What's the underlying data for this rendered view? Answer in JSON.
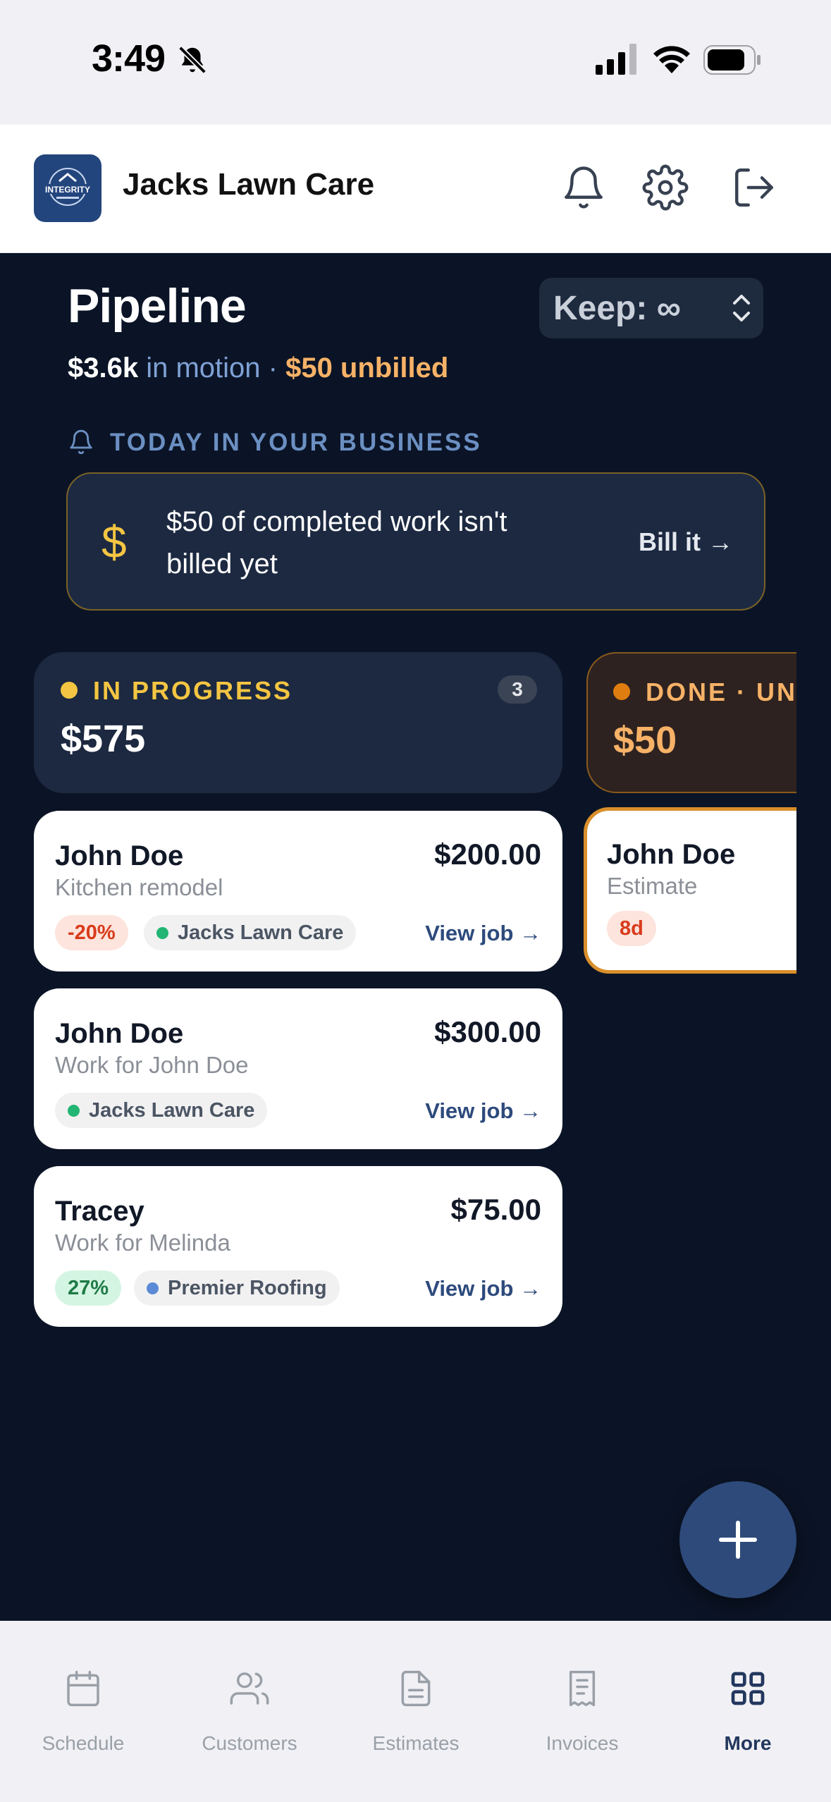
{
  "status_bar": {
    "time": "3:49"
  },
  "header": {
    "app_name": "Jacks Lawn Care",
    "logo_text": "INTEGRITY"
  },
  "pipeline": {
    "title": "Pipeline",
    "keep_select": "Keep: ∞",
    "summary": {
      "in_motion_value": "$3.6k",
      "in_motion_label": " in motion · ",
      "unbilled": "$50 unbilled"
    },
    "today_label": "TODAY IN YOUR BUSINESS",
    "alert": {
      "icon": "$",
      "text": "$50 of completed work isn't billed yet",
      "action": "Bill it →"
    }
  },
  "columns": {
    "in_progress": {
      "label": "IN PROGRESS",
      "count": "3",
      "amount": "$575",
      "dot_color": "#f4c542"
    },
    "done": {
      "label": "DONE · UNBILLED",
      "amount": "$50",
      "dot_color": "#e07d10"
    }
  },
  "cards": [
    {
      "name": "John Doe",
      "amount": "$200.00",
      "subtitle": "Kitchen remodel",
      "badge": "-20%",
      "company": "Jacks Lawn Care",
      "company_dot": "#22b573",
      "action": "View job →"
    },
    {
      "name": "John Doe",
      "amount": "$300.00",
      "subtitle": "Work for John Doe",
      "company": "Jacks Lawn Care",
      "company_dot": "#22b573",
      "action": "View job →"
    },
    {
      "name": "Tracey",
      "amount": "$75.00",
      "subtitle": "Work for Melinda",
      "badge": "27%",
      "company": "Premier Roofing",
      "company_dot": "#5b8bd6",
      "action": "View job →"
    }
  ],
  "done_card": {
    "name": "John Doe",
    "subtitle": "Estimate",
    "badge": "8d"
  },
  "fab": {
    "icon": "plus-icon"
  },
  "tabs": [
    {
      "label": "Schedule",
      "icon": "calendar-icon"
    },
    {
      "label": "Customers",
      "icon": "users-icon"
    },
    {
      "label": "Estimates",
      "icon": "document-icon"
    },
    {
      "label": "Invoices",
      "icon": "receipt-icon"
    },
    {
      "label": "More",
      "icon": "grid-icon",
      "active": true
    }
  ]
}
